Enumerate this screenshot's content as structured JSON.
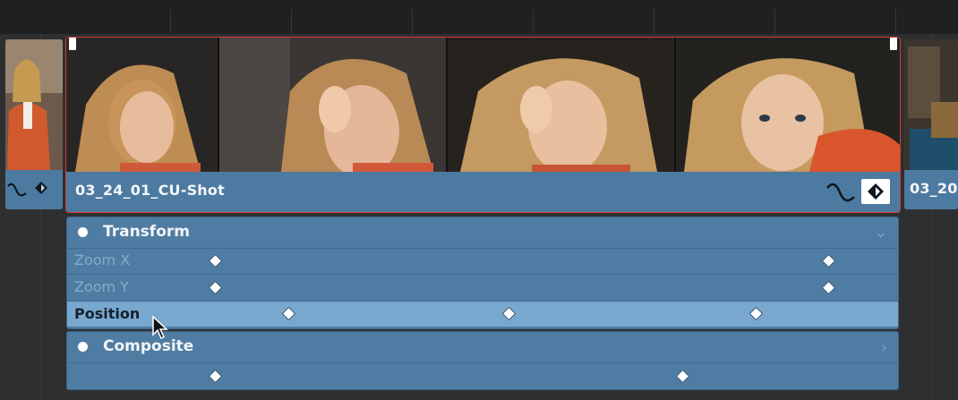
{
  "timeline": {
    "clips": [
      {
        "name": "",
        "role": "previous-clip"
      },
      {
        "name": "03_24_01_CU-Shot",
        "role": "selected-clip",
        "selected": true
      },
      {
        "name": "03_20",
        "role": "next-clip"
      }
    ],
    "selection_color": "#d83a3c",
    "clip_color": "#507ea3"
  },
  "keyframes": {
    "transform": {
      "title": "Transform",
      "collapse_icon": "chevron-down-icon",
      "rows": [
        {
          "label": "Zoom X",
          "active": false
        },
        {
          "label": "Zoom Y",
          "active": false
        },
        {
          "label": "Position",
          "active": true
        }
      ]
    },
    "composite": {
      "title": "Composite",
      "collapse_icon": "chevron-right-icon"
    }
  },
  "icons": {
    "curve": "curve-icon",
    "keyframe_toggle": "keyframe-icon",
    "cursor": "mouse-pointer-icon"
  }
}
